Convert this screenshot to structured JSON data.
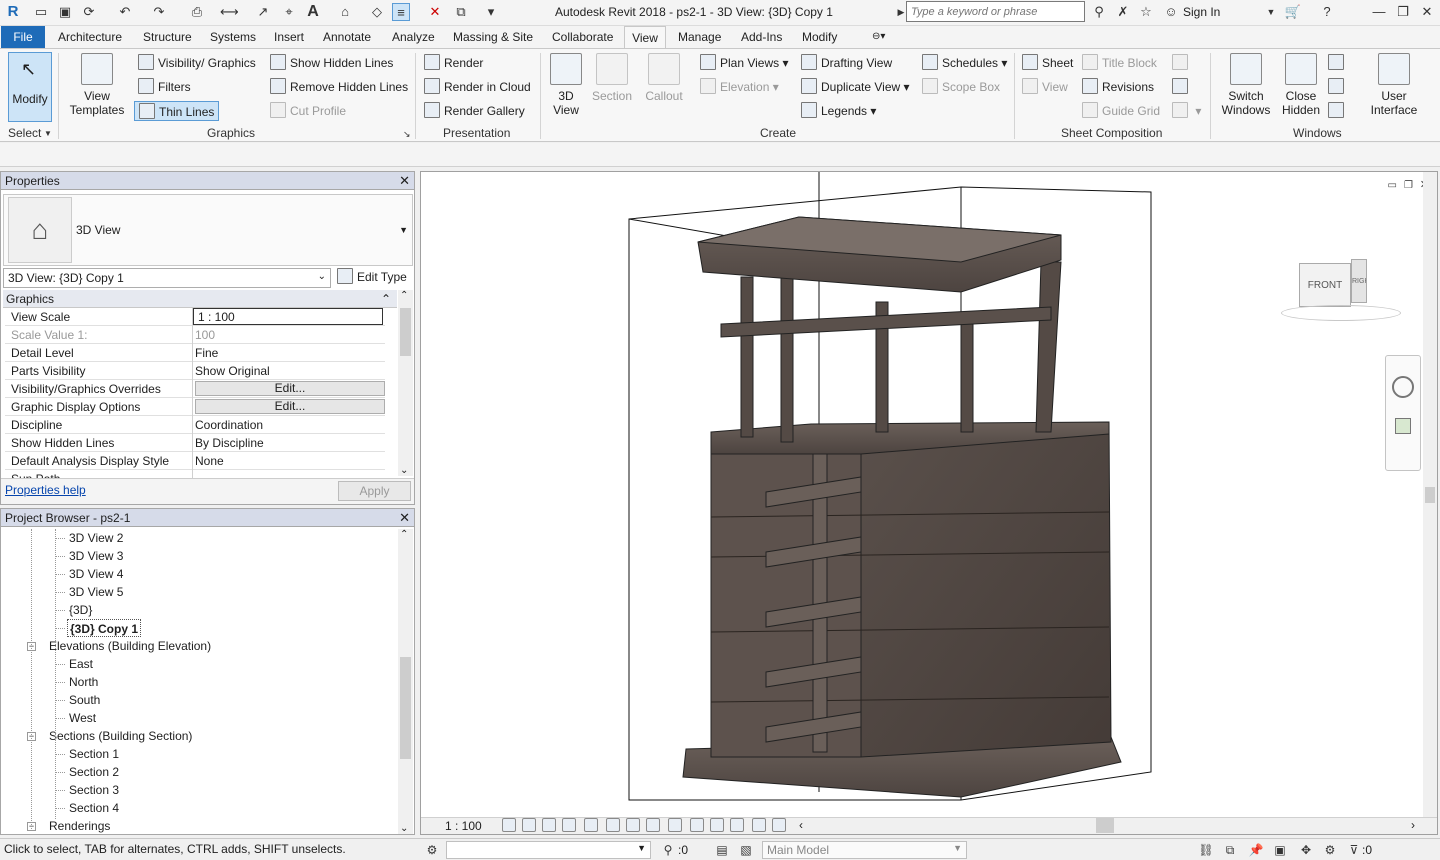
{
  "app": {
    "title": "Autodesk Revit 2018 -     ps2-1 - 3D View: {3D} Copy 1",
    "search_placeholder": "Type a keyword or phrase",
    "sign_in": "Sign In",
    "logo": "R"
  },
  "tabs": [
    "File",
    "Architecture",
    "Structure",
    "Systems",
    "Insert",
    "Annotate",
    "Analyze",
    "Massing & Site",
    "Collaborate",
    "View",
    "Manage",
    "Add-Ins",
    "Modify"
  ],
  "active_tab": "View",
  "ribbon": {
    "select": {
      "modify": "Modify",
      "label": "Select"
    },
    "graphics": {
      "view_templates": "View Templates",
      "visibility_graphics": "Visibility/ Graphics",
      "filters": "Filters",
      "thin_lines": "Thin Lines",
      "show_hidden_lines": "Show  Hidden Lines",
      "remove_hidden_lines": "Remove  Hidden Lines",
      "cut_profile": "Cut  Profile",
      "label": "Graphics"
    },
    "presentation": {
      "render": "Render",
      "render_in_cloud": "Render  in Cloud",
      "render_gallery": "Render  Gallery",
      "label": "Presentation"
    },
    "create": {
      "view3d": "3D View",
      "section": "Section",
      "callout": "Callout",
      "plan_views": "Plan  Views",
      "elevation": "Elevation",
      "drafting_view": "Drafting  View",
      "duplicate_view": "Duplicate  View",
      "legends": "Legends",
      "schedules": "Schedules",
      "scope_box": "Scope  Box",
      "label": "Create"
    },
    "sheet": {
      "sheet": "Sheet",
      "view": "View",
      "title_block": "Title  Block",
      "revisions": "Revisions",
      "guide_grid": "Guide  Grid",
      "label": "Sheet Composition"
    },
    "windows": {
      "switch_windows": "Switch Windows",
      "close_hidden": "Close Hidden",
      "user_interface": "User Interface",
      "label": "Windows"
    }
  },
  "properties": {
    "title": "Properties",
    "type_name": "3D View",
    "instance": "3D View: {3D} Copy 1",
    "edit_type": "Edit Type",
    "section": "Graphics",
    "rows": [
      {
        "key": "View Scale",
        "value": "1 : 100"
      },
      {
        "key": "Scale Value    1:",
        "value": "100"
      },
      {
        "key": "Detail Level",
        "value": "Fine"
      },
      {
        "key": "Parts Visibility",
        "value": "Show Original"
      },
      {
        "key": "Visibility/Graphics Overrides",
        "value": "Edit..."
      },
      {
        "key": "Graphic Display Options",
        "value": "Edit..."
      },
      {
        "key": "Discipline",
        "value": "Coordination"
      },
      {
        "key": "Show Hidden Lines",
        "value": "By Discipline"
      },
      {
        "key": "Default Analysis Display Style",
        "value": "None"
      },
      {
        "key": "Sun Path",
        "value": ""
      }
    ],
    "help": "Properties help",
    "apply": "Apply"
  },
  "browser": {
    "title": "Project Browser - ps2-1",
    "items": [
      {
        "label": "3D View 2",
        "level": 2
      },
      {
        "label": "3D View 3",
        "level": 2
      },
      {
        "label": "3D View 4",
        "level": 2
      },
      {
        "label": "3D View 5",
        "level": 2
      },
      {
        "label": "{3D}",
        "level": 2
      },
      {
        "label": "{3D} Copy 1",
        "level": 2
      },
      {
        "label": "Elevations (Building Elevation)",
        "level": 1
      },
      {
        "label": "East",
        "level": 2
      },
      {
        "label": "North",
        "level": 2
      },
      {
        "label": "South",
        "level": 2
      },
      {
        "label": "West",
        "level": 2
      },
      {
        "label": "Sections (Building Section)",
        "level": 1
      },
      {
        "label": "Section 1",
        "level": 2
      },
      {
        "label": "Section 2",
        "level": 2
      },
      {
        "label": "Section 3",
        "level": 2
      },
      {
        "label": "Section 4",
        "level": 2
      },
      {
        "label": "Renderings",
        "level": 1
      }
    ],
    "selected": "{3D} Copy 1"
  },
  "viewport": {
    "scale": "1 : 100",
    "viewcube_front": "FRONT",
    "viewcube_right": "RIGHT"
  },
  "status": {
    "message": "Click to select, TAB for alternates, CTRL adds, SHIFT unselects.",
    "selection_count": ":0",
    "model": "Main Model",
    "filter_count": ":0"
  },
  "colors": {
    "file_tab": "#1e6bb8",
    "panel_title": "#d6dbe9",
    "concrete": "#5a504b",
    "highlight": "#cde4f7"
  }
}
